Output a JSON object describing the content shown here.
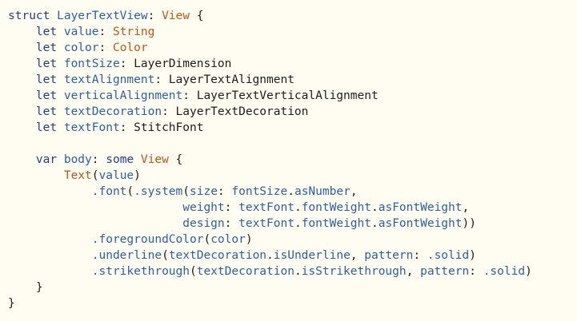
{
  "code": {
    "lines": [
      [
        {
          "t": "struct ",
          "c": "kw"
        },
        {
          "t": "LayerTextView",
          "c": "id"
        },
        {
          "t": ": ",
          "c": "pl"
        },
        {
          "t": "View",
          "c": "ty"
        },
        {
          "t": " {",
          "c": "pl"
        }
      ],
      [
        {
          "t": "    let ",
          "c": "kw"
        },
        {
          "t": "value",
          "c": "id"
        },
        {
          "t": ": ",
          "c": "pl"
        },
        {
          "t": "String",
          "c": "ty"
        }
      ],
      [
        {
          "t": "    let ",
          "c": "kw"
        },
        {
          "t": "color",
          "c": "id"
        },
        {
          "t": ": ",
          "c": "pl"
        },
        {
          "t": "Color",
          "c": "ty"
        }
      ],
      [
        {
          "t": "    let ",
          "c": "kw"
        },
        {
          "t": "fontSize",
          "c": "id"
        },
        {
          "t": ": LayerDimension",
          "c": "pl"
        }
      ],
      [
        {
          "t": "    let ",
          "c": "kw"
        },
        {
          "t": "textAlignment",
          "c": "id"
        },
        {
          "t": ": LayerTextAlignment",
          "c": "pl"
        }
      ],
      [
        {
          "t": "    let ",
          "c": "kw"
        },
        {
          "t": "verticalAlignment",
          "c": "id"
        },
        {
          "t": ": LayerTextVerticalAlignment",
          "c": "pl"
        }
      ],
      [
        {
          "t": "    let ",
          "c": "kw"
        },
        {
          "t": "textDecoration",
          "c": "id"
        },
        {
          "t": ": LayerTextDecoration",
          "c": "pl"
        }
      ],
      [
        {
          "t": "    let ",
          "c": "kw"
        },
        {
          "t": "textFont",
          "c": "id"
        },
        {
          "t": ": StitchFont",
          "c": "pl"
        }
      ],
      [],
      [
        {
          "t": "    var ",
          "c": "kw"
        },
        {
          "t": "body",
          "c": "id"
        },
        {
          "t": ": ",
          "c": "pl"
        },
        {
          "t": "some ",
          "c": "kw"
        },
        {
          "t": "View",
          "c": "ty"
        },
        {
          "t": " {",
          "c": "pl"
        }
      ],
      [
        {
          "t": "        ",
          "c": "pl"
        },
        {
          "t": "Text",
          "c": "ty"
        },
        {
          "t": "(",
          "c": "pl"
        },
        {
          "t": "value",
          "c": "id"
        },
        {
          "t": ")",
          "c": "pl"
        }
      ],
      [
        {
          "t": "            ",
          "c": "pl"
        },
        {
          "t": ".font",
          "c": "id"
        },
        {
          "t": "(",
          "c": "pl"
        },
        {
          "t": ".system",
          "c": "id"
        },
        {
          "t": "(",
          "c": "pl"
        },
        {
          "t": "size",
          "c": "id"
        },
        {
          "t": ": ",
          "c": "pl"
        },
        {
          "t": "fontSize",
          "c": "id"
        },
        {
          "t": ".",
          "c": "pl"
        },
        {
          "t": "asNumber",
          "c": "id"
        },
        {
          "t": ",",
          "c": "pl"
        }
      ],
      [
        {
          "t": "                         ",
          "c": "pl"
        },
        {
          "t": "weight",
          "c": "id"
        },
        {
          "t": ": ",
          "c": "pl"
        },
        {
          "t": "textFont",
          "c": "id"
        },
        {
          "t": ".",
          "c": "pl"
        },
        {
          "t": "fontWeight",
          "c": "id"
        },
        {
          "t": ".",
          "c": "pl"
        },
        {
          "t": "asFontWeight",
          "c": "id"
        },
        {
          "t": ",",
          "c": "pl"
        }
      ],
      [
        {
          "t": "                         ",
          "c": "pl"
        },
        {
          "t": "design",
          "c": "id"
        },
        {
          "t": ": ",
          "c": "pl"
        },
        {
          "t": "textFont",
          "c": "id"
        },
        {
          "t": ".",
          "c": "pl"
        },
        {
          "t": "fontWeight",
          "c": "id"
        },
        {
          "t": ".",
          "c": "pl"
        },
        {
          "t": "asFontWeight",
          "c": "id"
        },
        {
          "t": "))",
          "c": "pl"
        }
      ],
      [
        {
          "t": "            ",
          "c": "pl"
        },
        {
          "t": ".foregroundColor",
          "c": "id"
        },
        {
          "t": "(",
          "c": "pl"
        },
        {
          "t": "color",
          "c": "id"
        },
        {
          "t": ")",
          "c": "pl"
        }
      ],
      [
        {
          "t": "            ",
          "c": "pl"
        },
        {
          "t": ".underline",
          "c": "id"
        },
        {
          "t": "(",
          "c": "pl"
        },
        {
          "t": "textDecoration",
          "c": "id"
        },
        {
          "t": ".",
          "c": "pl"
        },
        {
          "t": "isUnderline",
          "c": "id"
        },
        {
          "t": ", ",
          "c": "pl"
        },
        {
          "t": "pattern",
          "c": "id"
        },
        {
          "t": ": ",
          "c": "pl"
        },
        {
          "t": ".solid",
          "c": "id"
        },
        {
          "t": ")",
          "c": "pl"
        }
      ],
      [
        {
          "t": "            ",
          "c": "pl"
        },
        {
          "t": ".strikethrough",
          "c": "id"
        },
        {
          "t": "(",
          "c": "pl"
        },
        {
          "t": "textDecoration",
          "c": "id"
        },
        {
          "t": ".",
          "c": "pl"
        },
        {
          "t": "isStrikethrough",
          "c": "id"
        },
        {
          "t": ", ",
          "c": "pl"
        },
        {
          "t": "pattern",
          "c": "id"
        },
        {
          "t": ": ",
          "c": "pl"
        },
        {
          "t": ".solid",
          "c": "id"
        },
        {
          "t": ")",
          "c": "pl"
        }
      ],
      [
        {
          "t": "    }",
          "c": "pl"
        }
      ],
      [
        {
          "t": "}",
          "c": "pl"
        }
      ]
    ]
  }
}
